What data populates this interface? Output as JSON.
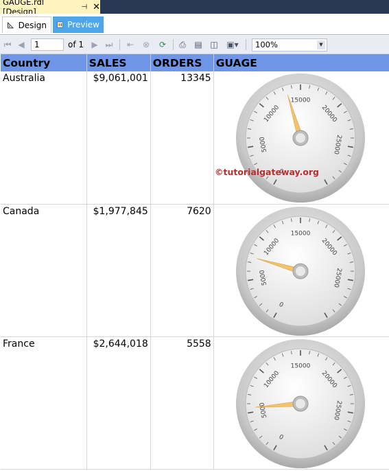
{
  "window": {
    "doc_tab_label": "GAUGE.rdl [Design]",
    "pin_icon": "⊣",
    "close_icon": "✕"
  },
  "view_tabs": {
    "design": "Design",
    "preview": "Preview"
  },
  "toolbar": {
    "page_value": "1",
    "of_label": "of 1",
    "zoom": "100%"
  },
  "report": {
    "headers": [
      "Country",
      "SALES",
      "ORDERS",
      "GUAGE"
    ],
    "rows": [
      {
        "country": "Australia",
        "sales": "$9,061,001",
        "orders": "13345",
        "gauge_value": 13345
      },
      {
        "country": "Canada",
        "sales": "$1,977,845",
        "orders": "7620",
        "gauge_value": 7620
      },
      {
        "country": "France",
        "sales": "$2,644,018",
        "orders": "5558",
        "gauge_value": 5558
      }
    ],
    "gauge_labels": [
      "5000",
      "10000",
      "15000",
      "20000",
      "25000",
      "0"
    ],
    "gauge_min": 0,
    "gauge_max": 30000
  },
  "watermark": "©tutorialgateway.org",
  "colors": {
    "header_bg": "#6f95e6",
    "needle": "#f2c36b",
    "tab_active": "#fdf4bf",
    "preview_tab": "#4da6e8"
  }
}
